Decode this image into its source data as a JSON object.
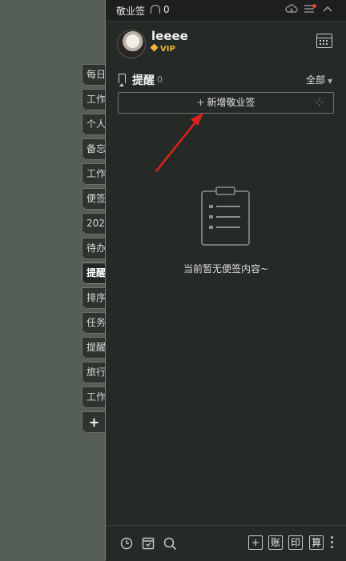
{
  "side_tabs": [
    {
      "label": "每日"
    },
    {
      "label": "工作"
    },
    {
      "label": "个人"
    },
    {
      "label": "备忘"
    },
    {
      "label": "工作"
    },
    {
      "label": "便签"
    },
    {
      "label": "202"
    },
    {
      "label": "待办"
    },
    {
      "label": "提醒",
      "active": true
    },
    {
      "label": "排序"
    },
    {
      "label": "任务"
    },
    {
      "label": "提醒"
    },
    {
      "label": "旅行"
    },
    {
      "label": "工作"
    },
    {
      "label": "+"
    }
  ],
  "titlebar": {
    "title": "敬业签",
    "bell_count": "0",
    "icons": [
      "cloud-icon",
      "menu-icon",
      "collapse-icon"
    ]
  },
  "user": {
    "name": "leeee",
    "badge": "VIP"
  },
  "section": {
    "title": "提醒",
    "count": "0",
    "filter": "全部"
  },
  "add_button": {
    "plus": "+",
    "label": "新增敬业签"
  },
  "empty_state": {
    "text": "当前暂无便签内容~"
  },
  "bottom_bar": {
    "icons": [
      "clock-icon",
      "archive-icon",
      "search-icon"
    ],
    "keys": [
      "+",
      "账",
      "印",
      "算"
    ]
  },
  "colors": {
    "desktop": "#565f56",
    "panel": "#262a27",
    "vip": "#f0b43c",
    "annotation_arrow": "#e0201c"
  }
}
